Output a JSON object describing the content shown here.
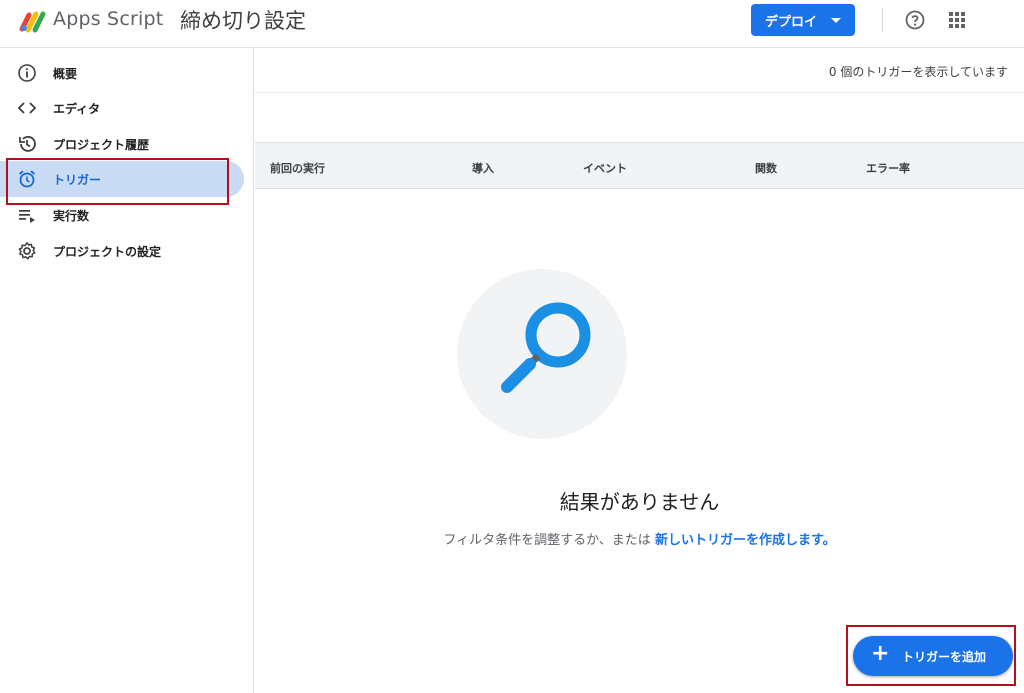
{
  "header": {
    "app_name": "Apps Script",
    "project_title": "締め切り設定",
    "deploy_label": "デプロイ",
    "help_icon": "help-circle-icon",
    "apps_icon": "apps-grid-icon"
  },
  "sidebar": {
    "items": [
      {
        "label": "概要",
        "icon": "info-icon",
        "active": false
      },
      {
        "label": "エディタ",
        "icon": "code-icon",
        "active": false
      },
      {
        "label": "プロジェクト履歴",
        "icon": "history-icon",
        "active": false
      },
      {
        "label": "トリガー",
        "icon": "alarm-clock-icon",
        "active": true
      },
      {
        "label": "実行数",
        "icon": "playlist-play-icon",
        "active": false
      },
      {
        "label": "プロジェクトの設定",
        "icon": "gear-icon",
        "active": false
      }
    ]
  },
  "main": {
    "summary": "0 個のトリガーを表示しています",
    "columns": [
      "前回の実行",
      "導入",
      "イベント",
      "関数",
      "エラー率"
    ],
    "empty_title": "結果がありません",
    "empty_text": "フィルタ条件を調整するか、または",
    "empty_link": "新しいトリガーを作成します。",
    "empty_icon": "search-magnifier-icon"
  },
  "fab": {
    "plus": "+",
    "label": "トリガーを追加"
  },
  "colors": {
    "accent": "#1a73e8",
    "active_bg": "#c9dbf5",
    "highlight_box": "#b3101b"
  }
}
